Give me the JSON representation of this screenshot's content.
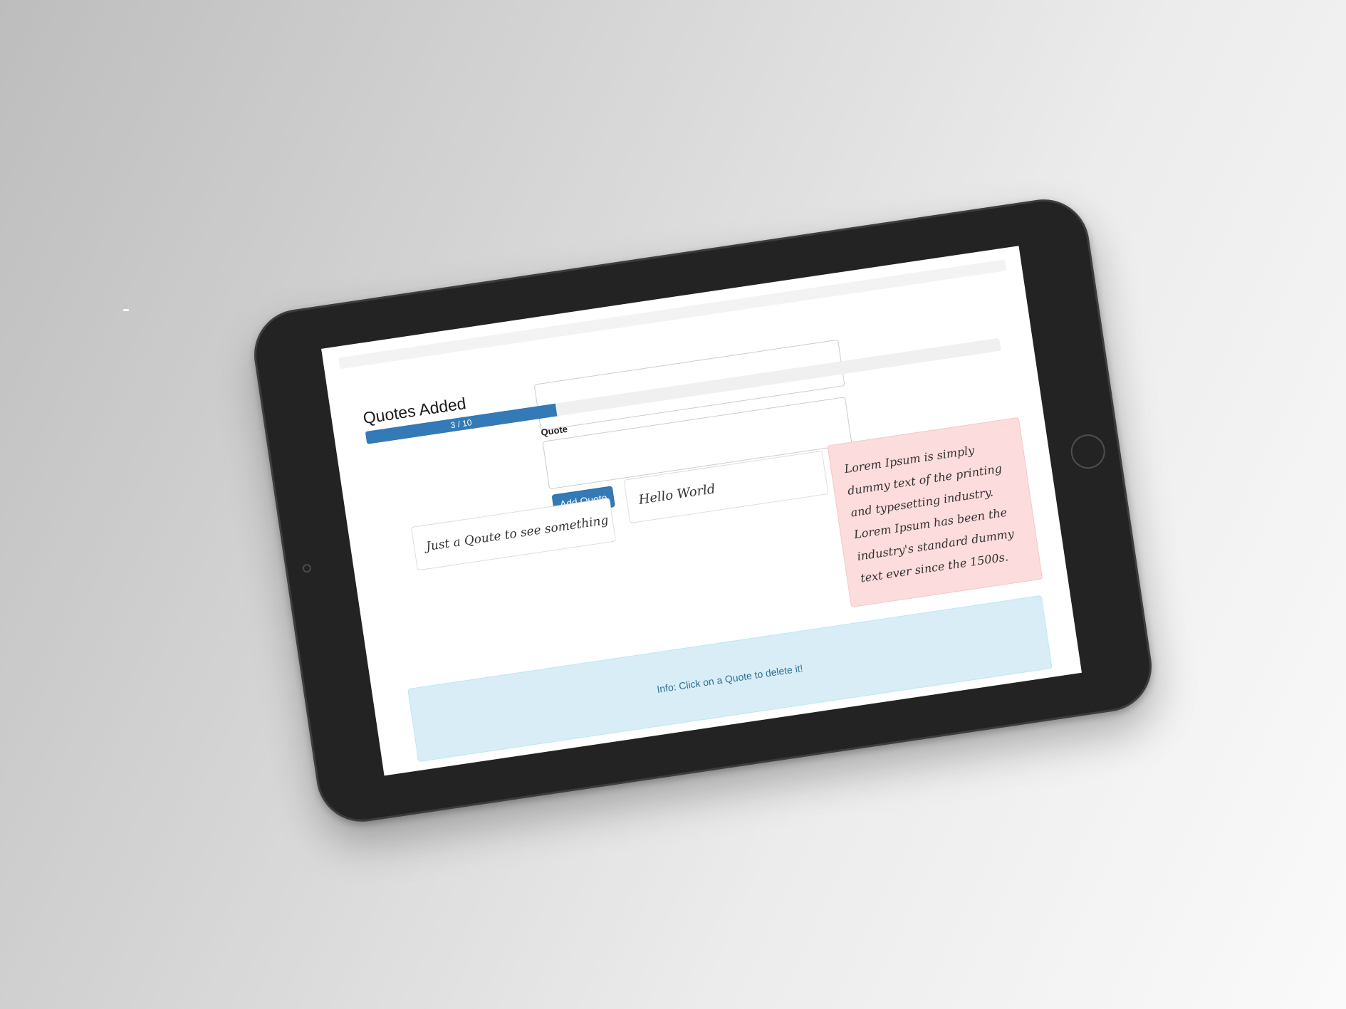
{
  "header": {
    "title": "Quotes Added"
  },
  "progress": {
    "current": 3,
    "max": 10,
    "label": "3 / 10",
    "fraction": 0.3,
    "color": "#337ab7"
  },
  "form": {
    "quote_label": "Quote",
    "quote_value": "",
    "add_button_label": "Add Quote"
  },
  "quotes": [
    {
      "text": "Just a Qoute to see something",
      "background": "#ffffff"
    },
    {
      "text": "Hello World",
      "background": "#ffffff"
    },
    {
      "text": "Lorem Ipsum is simply dummy text of the printing and typesetting industry. Lorem Ipsum has been the industry's standard dummy text ever since the 1500s.",
      "background": "#fcdcdc"
    }
  ],
  "info": {
    "message": "Info: Click on a Quote to delete it!",
    "background": "#d9edf7"
  }
}
